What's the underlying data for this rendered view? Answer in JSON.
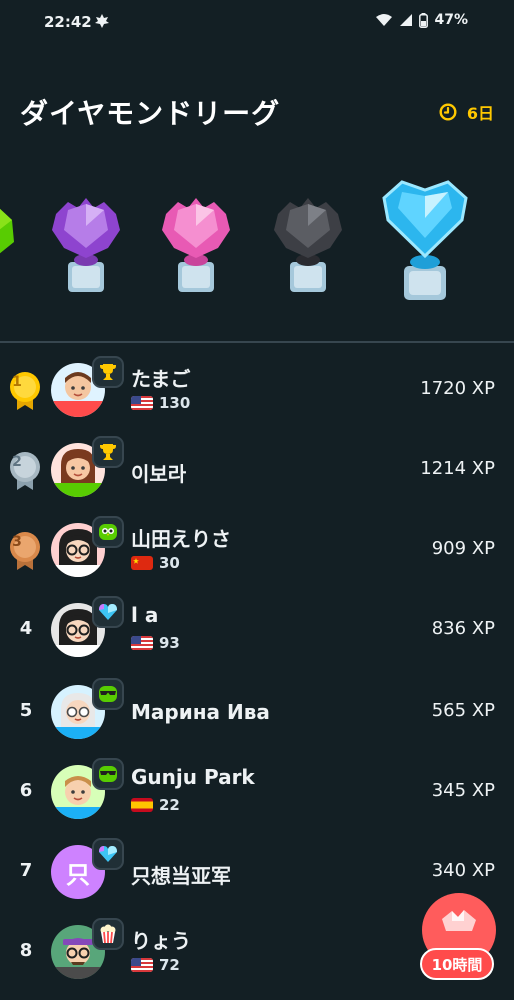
{
  "status_bar": {
    "time": "22:42",
    "battery": "47%"
  },
  "header": {
    "title": "ダイヤモンドリーグ",
    "time_left": "6日"
  },
  "colors": {
    "background": "#131f24",
    "accent_time": "#ffc800",
    "divider": "#37464f",
    "gold": "#ffc800",
    "silver": "#a7b8c2",
    "bronze": "#d9894b",
    "fab": "#ff5c5c"
  },
  "leagues": [
    {
      "name": "emerald",
      "color": "#58cc02"
    },
    {
      "name": "amethyst",
      "color": "#a35bd9"
    },
    {
      "name": "pearl",
      "color": "#f06ec4"
    },
    {
      "name": "obsidian",
      "color": "#5b5d63"
    },
    {
      "name": "diamond",
      "color": "#3dc4f5",
      "current": true
    }
  ],
  "leaderboard": [
    {
      "rank": "1",
      "name": "たまご",
      "flag": "us",
      "streak": "130",
      "xp": "1720 XP",
      "medal": "gold",
      "badge": "trophy-icon"
    },
    {
      "rank": "2",
      "name": "이보라",
      "flag": "",
      "streak": "",
      "xp": "1214 XP",
      "medal": "silver",
      "badge": "trophy-icon"
    },
    {
      "rank": "3",
      "name": "山田えりさ",
      "flag": "cn",
      "streak": "30",
      "xp": "909 XP",
      "medal": "bronze",
      "badge": "owl-icon"
    },
    {
      "rank": "4",
      "name": "l a",
      "flag": "us",
      "streak": "93",
      "xp": "836 XP",
      "medal": "",
      "badge": "diamond-heart-icon"
    },
    {
      "rank": "5",
      "name": "Марина Ива",
      "flag": "",
      "streak": "",
      "xp": "565 XP",
      "medal": "",
      "badge": "sunglasses-owl-icon"
    },
    {
      "rank": "6",
      "name": "Gunju Park",
      "flag": "es",
      "streak": "22",
      "xp": "345 XP",
      "medal": "",
      "badge": "sunglasses-owl-icon"
    },
    {
      "rank": "7",
      "name": "只想当亚军",
      "flag": "",
      "streak": "",
      "xp": "340 XP",
      "medal": "",
      "badge": "diamond-heart-icon",
      "initial": "只"
    },
    {
      "rank": "8",
      "name": "りょう",
      "flag": "us",
      "streak": "72",
      "xp": "",
      "medal": "",
      "badge": "popcorn-icon"
    }
  ],
  "fab": {
    "label": "10時間"
  }
}
